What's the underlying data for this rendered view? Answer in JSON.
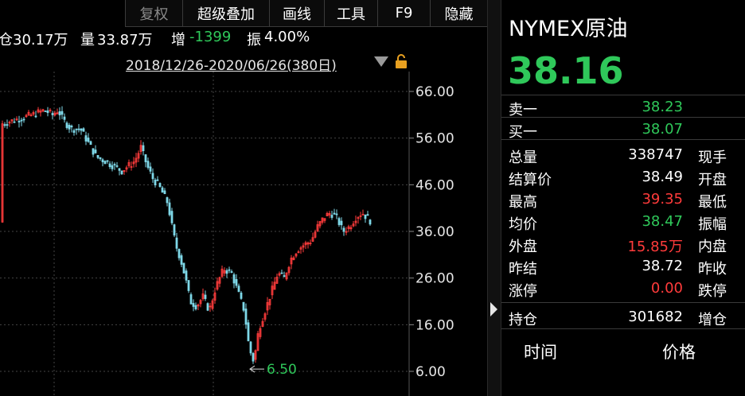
{
  "toolbar": {
    "fuquan": "复权",
    "overlay": "超级叠加",
    "draw": "画线",
    "tools": "工具",
    "f9": "F9",
    "hide": "隐藏"
  },
  "infoline": {
    "position_label": "仓",
    "position_value": "30.17万",
    "volume_label": "量",
    "volume_value": "33.87万",
    "increase_label": "增",
    "increase_value": "-1399",
    "amplitude_label": "振",
    "amplitude_value": "4.00%"
  },
  "date_range": "2018/12/26-2020/06/26(380日)",
  "chart_data": {
    "type": "candlestick",
    "y_ticks": [
      "66.00",
      "56.00",
      "46.00",
      "36.00",
      "26.00",
      "16.00",
      "6.00"
    ],
    "ylim": [
      6,
      66
    ],
    "min_label": "6.50",
    "up_color": "#ff3b3b",
    "down_color": "#7fd8e8",
    "grid": true
  },
  "panel": {
    "title": "NYMEX原油",
    "price": "38.16",
    "rows": [
      {
        "label": "卖一",
        "value": "38.23",
        "color": "#2fc85a",
        "label2": ""
      },
      {
        "label": "买一",
        "value": "38.07",
        "color": "#2fc85a",
        "label2": ""
      },
      {
        "label": "总量",
        "value": "338747",
        "color": "#ffffff",
        "label2": "现手"
      },
      {
        "label": "结算价",
        "value": "38.49",
        "color": "#ffffff",
        "label2": "开盘"
      },
      {
        "label": "最高",
        "value": "39.35",
        "color": "#ff3b3b",
        "label2": "最低"
      },
      {
        "label": "均价",
        "value": "38.47",
        "color": "#2fc85a",
        "label2": "振幅"
      },
      {
        "label": "外盘",
        "value": "15.85万",
        "color": "#ff3b3b",
        "label2": "内盘"
      },
      {
        "label": "昨结",
        "value": "38.72",
        "color": "#ffffff",
        "label2": "昨收"
      },
      {
        "label": "涨停",
        "value": "0.00",
        "color": "#ff3b3b",
        "label2": "跌停"
      },
      {
        "label": "持仓",
        "value": "301682",
        "color": "#ffffff",
        "label2": "增仓"
      }
    ],
    "time_header": "时间",
    "price_header": "价格"
  }
}
